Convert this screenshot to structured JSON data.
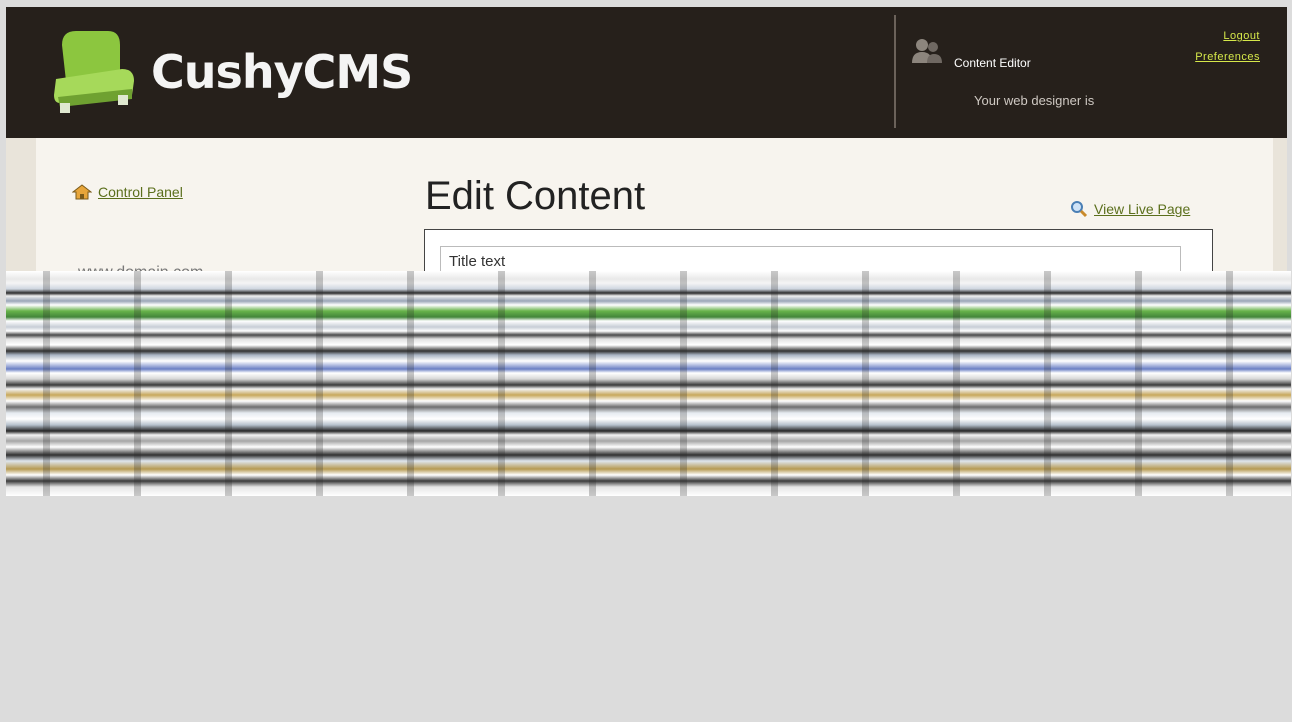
{
  "app": {
    "brand": "CushyCMS"
  },
  "header": {
    "role": "Content Editor",
    "designer_text": "Your web designer is",
    "logout_label": "Logout",
    "preferences_label": "Preferences"
  },
  "sidebar": {
    "control_panel_label": "Control Panel",
    "domain": "www.domain.com"
  },
  "main": {
    "title": "Edit Content",
    "view_live_label": "View Live Page",
    "title_field_value": "Title text"
  },
  "colors": {
    "header_bg": "#26201b",
    "link_green": "#5b6f1c",
    "header_link": "#d6e84a",
    "brand_green": "#8bc34a"
  },
  "icons": {
    "home": "home-icon",
    "magnifier": "magnifier-icon",
    "user": "user-icon",
    "logo": "chair-logo-icon"
  }
}
